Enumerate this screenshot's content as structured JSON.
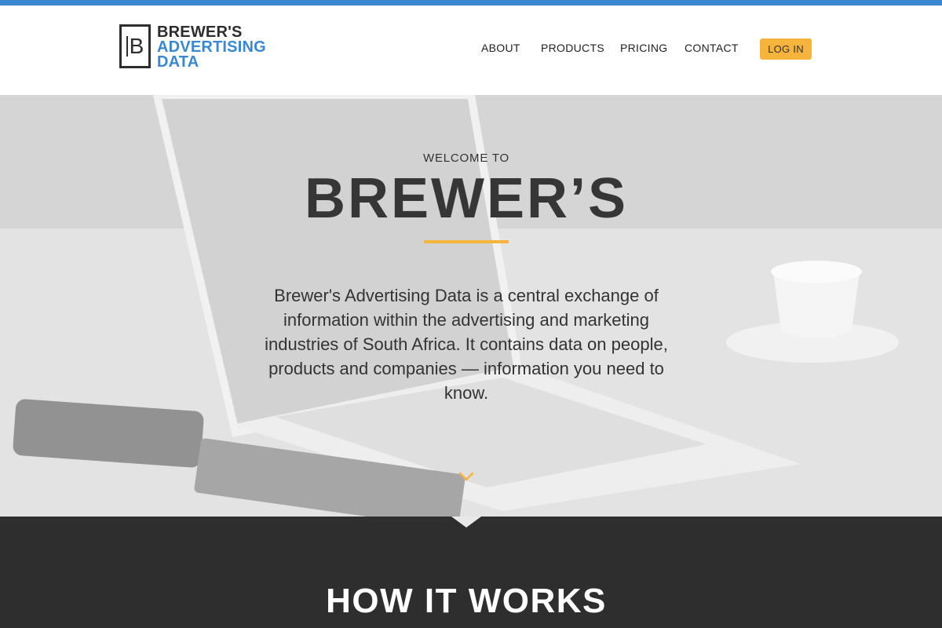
{
  "brand": {
    "logo_letter": "B",
    "line1": "BREWER'S",
    "line2": "ADVERTISING",
    "line3": "DATA"
  },
  "nav": {
    "items": [
      {
        "label": "ABOUT"
      },
      {
        "label": "PRODUCTS"
      },
      {
        "label": "PRICING"
      },
      {
        "label": "CONTACT"
      }
    ],
    "login_label": "LOG IN"
  },
  "hero": {
    "kicker": "WELCOME TO",
    "title": "BREWER’S",
    "description": "Brewer's Advertising Data is a central exchange of information within the advertising and marketing industries of South Africa. It contains data on people, products and companies — information you need to know.",
    "scroll_icon": "chevron-down-icon"
  },
  "how_it_works": {
    "title": "HOW IT WORKS"
  },
  "colors": {
    "accent_blue": "#3a88d1",
    "accent_yellow": "#f7b43c",
    "dark": "#2e2e2e"
  }
}
